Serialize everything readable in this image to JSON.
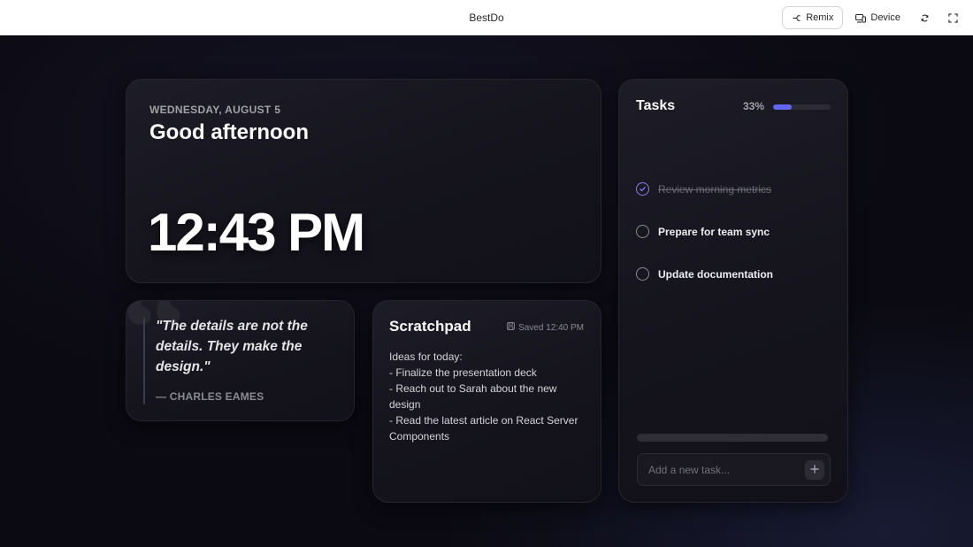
{
  "topbar": {
    "title": "BestDo",
    "remix_label": "Remix",
    "device_label": "Device",
    "icons": [
      "remix-icon",
      "device-icon",
      "refresh-icon",
      "fullscreen-icon"
    ]
  },
  "clock": {
    "date": "WEDNESDAY, AUGUST 5",
    "greeting": "Good afternoon",
    "time": "12:43 PM"
  },
  "quote": {
    "text": "\"The details are not the details. They make the design.\"",
    "author": "— CHARLES EAMES"
  },
  "scratchpad": {
    "title": "Scratchpad",
    "saved": "Saved 12:40 PM",
    "lines": [
      "Ideas for today:",
      "- Finalize the presentation deck",
      "- Reach out to Sarah about the new design",
      "- Read the latest article on React Server Components"
    ]
  },
  "tasks": {
    "title": "Tasks",
    "percent_label": "33%",
    "progress_fraction": 0.33,
    "items": [
      {
        "label": "Review morning metrics",
        "done": true
      },
      {
        "label": "Prepare for team sync",
        "done": false
      },
      {
        "label": "Update documentation",
        "done": false
      }
    ],
    "add_placeholder": "Add a new task..."
  },
  "colors": {
    "accent": "#6366f1",
    "background": "#0b0a12",
    "card": "#17161f"
  }
}
